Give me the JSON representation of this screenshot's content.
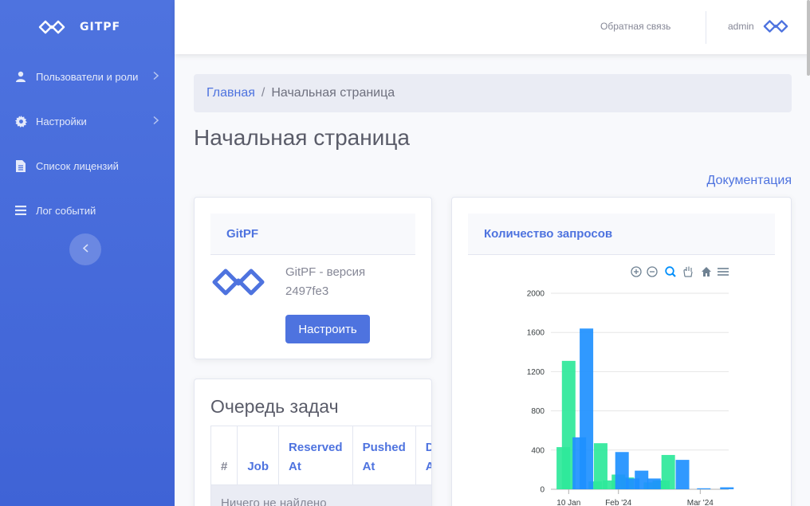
{
  "sidebar": {
    "brand": "GITPF",
    "items": [
      {
        "label": "Пользователи и роли",
        "icon": "user-icon",
        "has_submenu": true
      },
      {
        "label": "Настройки",
        "icon": "gear-icon",
        "has_submenu": true
      },
      {
        "label": "Список лицензий",
        "icon": "file-icon",
        "has_submenu": false
      },
      {
        "label": "Лог событий",
        "icon": "list-icon",
        "has_submenu": false
      }
    ],
    "toggle_icon": "chevron-left-icon"
  },
  "topbar": {
    "feedback": "Обратная связь",
    "user": "admin"
  },
  "breadcrumb": {
    "home": "Главная",
    "separator": "/",
    "current": "Начальная страница"
  },
  "page": {
    "title": "Начальная страница",
    "doc_link": "Документация"
  },
  "gitpf_card": {
    "title": "GitPF",
    "version_text": "GitPF - версия 2497fe3",
    "button": "Настроить"
  },
  "queue_card": {
    "title": "Очередь задач",
    "columns": [
      "#",
      "Job",
      "Reserved At",
      "Pushed At",
      "Done At"
    ],
    "empty_text": "Ничего не найдено"
  },
  "chart_card": {
    "title": "Количество запросов"
  },
  "colors": {
    "primary": "#4e73df",
    "series_green": "#2ee89a",
    "series_blue": "#1e90ff"
  },
  "chart_data": {
    "type": "bar",
    "y_ticks": [
      "0",
      "400",
      "800",
      "1200",
      "1600",
      "2000"
    ],
    "ylim": [
      0,
      2000
    ],
    "x_ticks": [
      "10 Jan",
      "Feb '24",
      "Mar '24"
    ],
    "toolbar": [
      "zoom-in-icon",
      "zoom-out-icon",
      "zoom-select-icon",
      "pan-icon",
      "reset-home-icon",
      "menu-icon"
    ],
    "series": [
      {
        "color": "#2ee89a",
        "points": [
          {
            "x": 0.35,
            "value": 430
          },
          {
            "x": 0.5,
            "value": 1310
          },
          {
            "x": 1.4,
            "value": 470
          },
          {
            "x": 1.25,
            "value": 80
          },
          {
            "x": 1.65,
            "value": 90
          },
          {
            "x": 1.9,
            "value": 150
          },
          {
            "x": 2.15,
            "value": 120
          },
          {
            "x": 2.8,
            "value": 70
          },
          {
            "x": 3.05,
            "value": 90
          },
          {
            "x": 3.3,
            "value": 350
          },
          {
            "x": 3.15,
            "value": 90
          }
        ]
      },
      {
        "color": "#1e90ff",
        "points": [
          {
            "x": 0.8,
            "value": 530
          },
          {
            "x": 1.0,
            "value": 1640
          },
          {
            "x": 2.0,
            "value": 380
          },
          {
            "x": 2.55,
            "value": 190
          },
          {
            "x": 2.9,
            "value": 110
          },
          {
            "x": 3.7,
            "value": 300
          },
          {
            "x": 2.3,
            "value": 110
          },
          {
            "x": 4.3,
            "value": 10
          },
          {
            "x": 4.95,
            "value": 20
          }
        ]
      }
    ]
  }
}
